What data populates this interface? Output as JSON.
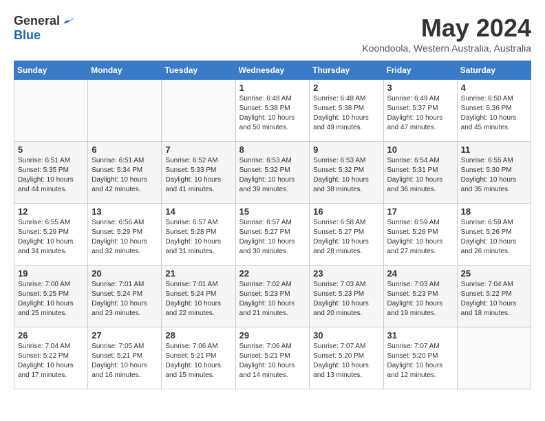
{
  "logo": {
    "general": "General",
    "blue": "Blue"
  },
  "title": "May 2024",
  "location": "Koondoola, Western Australia, Australia",
  "days_of_week": [
    "Sunday",
    "Monday",
    "Tuesday",
    "Wednesday",
    "Thursday",
    "Friday",
    "Saturday"
  ],
  "weeks": [
    {
      "shaded": false,
      "days": [
        {
          "num": "",
          "info": ""
        },
        {
          "num": "",
          "info": ""
        },
        {
          "num": "",
          "info": ""
        },
        {
          "num": "1",
          "info": "Sunrise: 6:48 AM\nSunset: 5:38 PM\nDaylight: 10 hours\nand 50 minutes."
        },
        {
          "num": "2",
          "info": "Sunrise: 6:48 AM\nSunset: 5:38 PM\nDaylight: 10 hours\nand 49 minutes."
        },
        {
          "num": "3",
          "info": "Sunrise: 6:49 AM\nSunset: 5:37 PM\nDaylight: 10 hours\nand 47 minutes."
        },
        {
          "num": "4",
          "info": "Sunrise: 6:50 AM\nSunset: 5:36 PM\nDaylight: 10 hours\nand 45 minutes."
        }
      ]
    },
    {
      "shaded": true,
      "days": [
        {
          "num": "5",
          "info": "Sunrise: 6:51 AM\nSunset: 5:35 PM\nDaylight: 10 hours\nand 44 minutes."
        },
        {
          "num": "6",
          "info": "Sunrise: 6:51 AM\nSunset: 5:34 PM\nDaylight: 10 hours\nand 42 minutes."
        },
        {
          "num": "7",
          "info": "Sunrise: 6:52 AM\nSunset: 5:33 PM\nDaylight: 10 hours\nand 41 minutes."
        },
        {
          "num": "8",
          "info": "Sunrise: 6:53 AM\nSunset: 5:32 PM\nDaylight: 10 hours\nand 39 minutes."
        },
        {
          "num": "9",
          "info": "Sunrise: 6:53 AM\nSunset: 5:32 PM\nDaylight: 10 hours\nand 38 minutes."
        },
        {
          "num": "10",
          "info": "Sunrise: 6:54 AM\nSunset: 5:31 PM\nDaylight: 10 hours\nand 36 minutes."
        },
        {
          "num": "11",
          "info": "Sunrise: 6:55 AM\nSunset: 5:30 PM\nDaylight: 10 hours\nand 35 minutes."
        }
      ]
    },
    {
      "shaded": false,
      "days": [
        {
          "num": "12",
          "info": "Sunrise: 6:55 AM\nSunset: 5:29 PM\nDaylight: 10 hours\nand 34 minutes."
        },
        {
          "num": "13",
          "info": "Sunrise: 6:56 AM\nSunset: 5:29 PM\nDaylight: 10 hours\nand 32 minutes."
        },
        {
          "num": "14",
          "info": "Sunrise: 6:57 AM\nSunset: 5:28 PM\nDaylight: 10 hours\nand 31 minutes."
        },
        {
          "num": "15",
          "info": "Sunrise: 6:57 AM\nSunset: 5:27 PM\nDaylight: 10 hours\nand 30 minutes."
        },
        {
          "num": "16",
          "info": "Sunrise: 6:58 AM\nSunset: 5:27 PM\nDaylight: 10 hours\nand 28 minutes."
        },
        {
          "num": "17",
          "info": "Sunrise: 6:59 AM\nSunset: 5:26 PM\nDaylight: 10 hours\nand 27 minutes."
        },
        {
          "num": "18",
          "info": "Sunrise: 6:59 AM\nSunset: 5:26 PM\nDaylight: 10 hours\nand 26 minutes."
        }
      ]
    },
    {
      "shaded": true,
      "days": [
        {
          "num": "19",
          "info": "Sunrise: 7:00 AM\nSunset: 5:25 PM\nDaylight: 10 hours\nand 25 minutes."
        },
        {
          "num": "20",
          "info": "Sunrise: 7:01 AM\nSunset: 5:24 PM\nDaylight: 10 hours\nand 23 minutes."
        },
        {
          "num": "21",
          "info": "Sunrise: 7:01 AM\nSunset: 5:24 PM\nDaylight: 10 hours\nand 22 minutes."
        },
        {
          "num": "22",
          "info": "Sunrise: 7:02 AM\nSunset: 5:23 PM\nDaylight: 10 hours\nand 21 minutes."
        },
        {
          "num": "23",
          "info": "Sunrise: 7:03 AM\nSunset: 5:23 PM\nDaylight: 10 hours\nand 20 minutes."
        },
        {
          "num": "24",
          "info": "Sunrise: 7:03 AM\nSunset: 5:23 PM\nDaylight: 10 hours\nand 19 minutes."
        },
        {
          "num": "25",
          "info": "Sunrise: 7:04 AM\nSunset: 5:22 PM\nDaylight: 10 hours\nand 18 minutes."
        }
      ]
    },
    {
      "shaded": false,
      "days": [
        {
          "num": "26",
          "info": "Sunrise: 7:04 AM\nSunset: 5:22 PM\nDaylight: 10 hours\nand 17 minutes."
        },
        {
          "num": "27",
          "info": "Sunrise: 7:05 AM\nSunset: 5:21 PM\nDaylight: 10 hours\nand 16 minutes."
        },
        {
          "num": "28",
          "info": "Sunrise: 7:06 AM\nSunset: 5:21 PM\nDaylight: 10 hours\nand 15 minutes."
        },
        {
          "num": "29",
          "info": "Sunrise: 7:06 AM\nSunset: 5:21 PM\nDaylight: 10 hours\nand 14 minutes."
        },
        {
          "num": "30",
          "info": "Sunrise: 7:07 AM\nSunset: 5:20 PM\nDaylight: 10 hours\nand 13 minutes."
        },
        {
          "num": "31",
          "info": "Sunrise: 7:07 AM\nSunset: 5:20 PM\nDaylight: 10 hours\nand 12 minutes."
        },
        {
          "num": "",
          "info": ""
        }
      ]
    }
  ]
}
